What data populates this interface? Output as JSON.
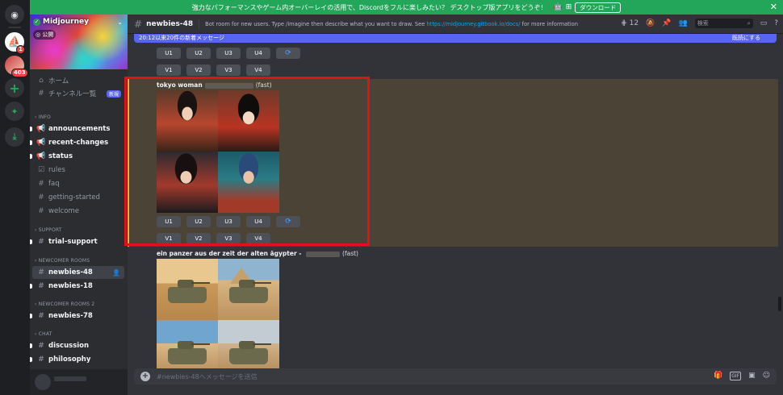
{
  "top_banner": {
    "text": "強力なパフォーマンスやゲーム内オーバーレイの活用で、Discordをフルに楽しみたい？ デスクトップ版アプリをどうぞ！",
    "download_label": "ダウンロード",
    "close_glyph": "✕"
  },
  "rail": {
    "home_glyph": "◉",
    "mj_glyph": "⛵",
    "mj_badge": "1",
    "s2_badge": "403",
    "add_glyph": "+",
    "explore_glyph": "✦",
    "download_glyph": "⤓"
  },
  "server": {
    "name": "Midjourney",
    "public_label": "公開",
    "home_label": "ホーム",
    "channel_list_label": "チャンネル一覧",
    "new_tag": "新規"
  },
  "categories": {
    "info": "INFO",
    "support": "SUPPORT",
    "newcomer": "NEWCOMER ROOMS",
    "newcomer2": "NEWCOMER ROOMS 2",
    "chat": "CHAT"
  },
  "channels": {
    "announcements": "announcements",
    "recent_changes": "recent-changes",
    "status": "status",
    "rules": "rules",
    "faq": "faq",
    "getting_started": "getting-started",
    "welcome": "welcome",
    "trial_support": "trial-support",
    "newbies48": "newbies-48",
    "newbies18": "newbies-18",
    "newbies78": "newbies-78",
    "discussion": "discussion",
    "philosophy": "philosophy"
  },
  "header": {
    "channel_name": "newbies-48",
    "topic": "Bot room for new users. Type /imagine then describe what you want to draw. See ",
    "topic_link": "https://midjourney.gitbook.io/docs/",
    "topic_tail": " for more information",
    "thread_count": "12",
    "search_placeholder": "検索"
  },
  "new_messages": {
    "text": "20:12以来20件の新着メッセージ",
    "mark_read": "既読にする"
  },
  "messages": {
    "upscale_labels": [
      "U1",
      "U2",
      "U3",
      "U4"
    ],
    "variation_labels": [
      "V1",
      "V2",
      "V3",
      "V4"
    ],
    "refresh_glyph": "⟳",
    "msg1_prompt": "tokyo woman",
    "msg1_speed": "(fast)",
    "msg2_prompt": "ein panzer aus der zeit der alten ägypter",
    "msg2_dash": " - ",
    "msg2_speed": "(fast)"
  },
  "composer": {
    "placeholder": "#newbies-48へメッセージを送信"
  },
  "colors": {
    "accent": "#5865f2",
    "banner_green": "#23a55a",
    "highlight": "#4a4336",
    "highlight_bar": "#f0b232",
    "annotation": "#e0111b"
  }
}
